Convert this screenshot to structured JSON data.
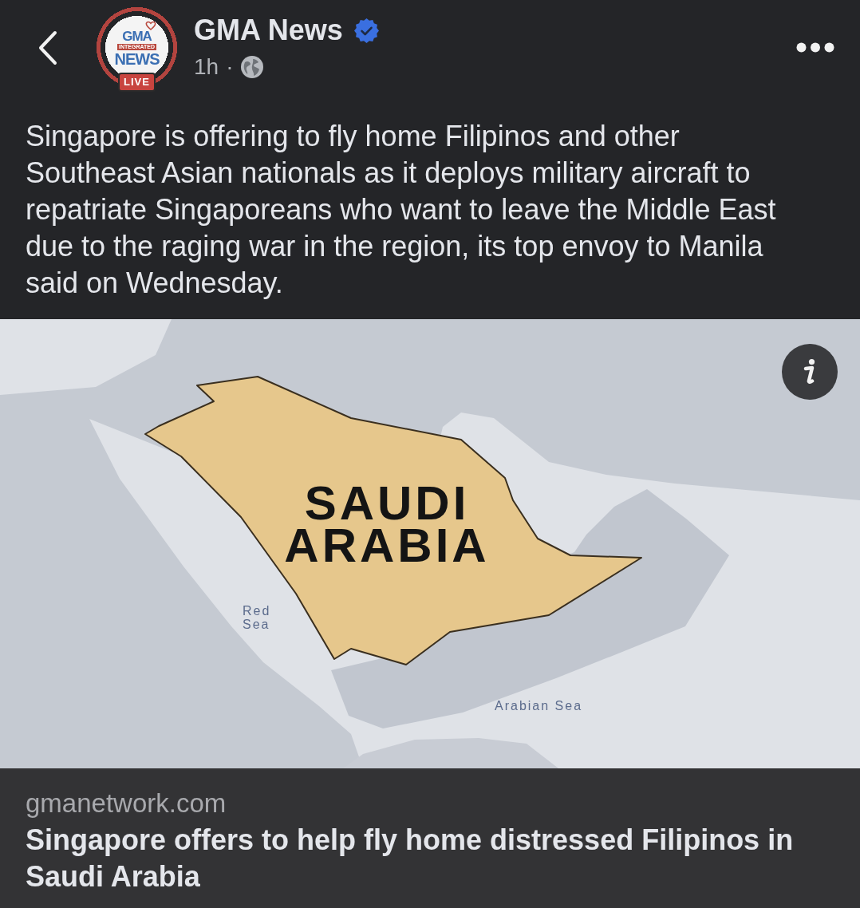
{
  "page": {
    "name": "GMA News",
    "verified": true,
    "time": "1h",
    "separator": "·",
    "logo": {
      "lines": [
        "GMA",
        "INTEGRATED",
        "NEWS"
      ],
      "badge": "LIVE"
    }
  },
  "post": {
    "text": "Singapore is offering to fly home Filipinos and other Southeast Asian nationals as it deploys military aircraft to repatriate Singaporeans who want to leave the Middle East due to the raging war in the region, its top envoy to Manila said on Wednesday."
  },
  "link_preview": {
    "map": {
      "labels": [
        {
          "kind": "country",
          "text": "SAUDI ARABIA"
        },
        {
          "kind": "sea",
          "text": "Red Sea"
        },
        {
          "kind": "sea",
          "text": "Arabian Sea"
        }
      ]
    },
    "domain": "gmanetwork.com",
    "title": "Singapore offers to help fly home distressed Filipinos in Saudi Arabia"
  }
}
